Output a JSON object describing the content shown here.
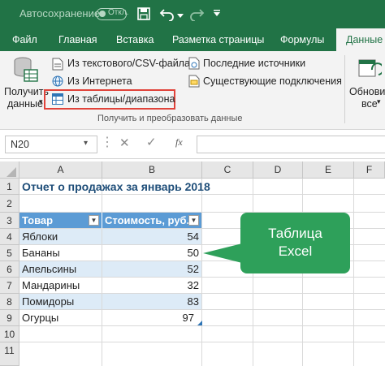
{
  "titlebar": {
    "autosave_label": "Автосохранение",
    "toggle_state": "Откл."
  },
  "tabs": [
    "Файл",
    "Главная",
    "Вставка",
    "Разметка страницы",
    "Формулы",
    "Данные"
  ],
  "ribbon": {
    "get_data_label_line1": "Получить",
    "get_data_label_line2": "данные",
    "from_text_csv": "Из текстового/CSV-файла",
    "from_web": "Из Интернета",
    "from_table": "Из таблицы/диапазона",
    "recent_sources": "Последние источники",
    "existing_connections": "Существующие подключения",
    "group_label": "Получить и преобразовать данные",
    "refresh_line1": "Обнови",
    "refresh_line2": "все"
  },
  "formula_bar": {
    "name_box": "N20",
    "fx": "fx",
    "value": ""
  },
  "columns": [
    "A",
    "B",
    "C",
    "D",
    "E",
    "F"
  ],
  "rows": [
    "1",
    "2",
    "3",
    "4",
    "5",
    "6",
    "7",
    "8",
    "9",
    "10",
    "11"
  ],
  "sheet": {
    "title": "Отчет о продажах за январь 2018",
    "table_headers": [
      "Товар",
      "Стоимость, руб."
    ],
    "table_rows": [
      [
        "Яблоки",
        "54"
      ],
      [
        "Бананы",
        "50"
      ],
      [
        "Апельсины",
        "52"
      ],
      [
        "Мандарины",
        "32"
      ],
      [
        "Помидоры",
        "83"
      ],
      [
        "Огурцы",
        "97"
      ]
    ]
  },
  "callout": {
    "line1": "Таблица",
    "line2": "Excel"
  },
  "colors": {
    "excel_green": "#217346",
    "table_header": "#5b9bd5",
    "band": "#ddebf7",
    "callout": "#2ea05a",
    "highlight": "#e0433a"
  }
}
